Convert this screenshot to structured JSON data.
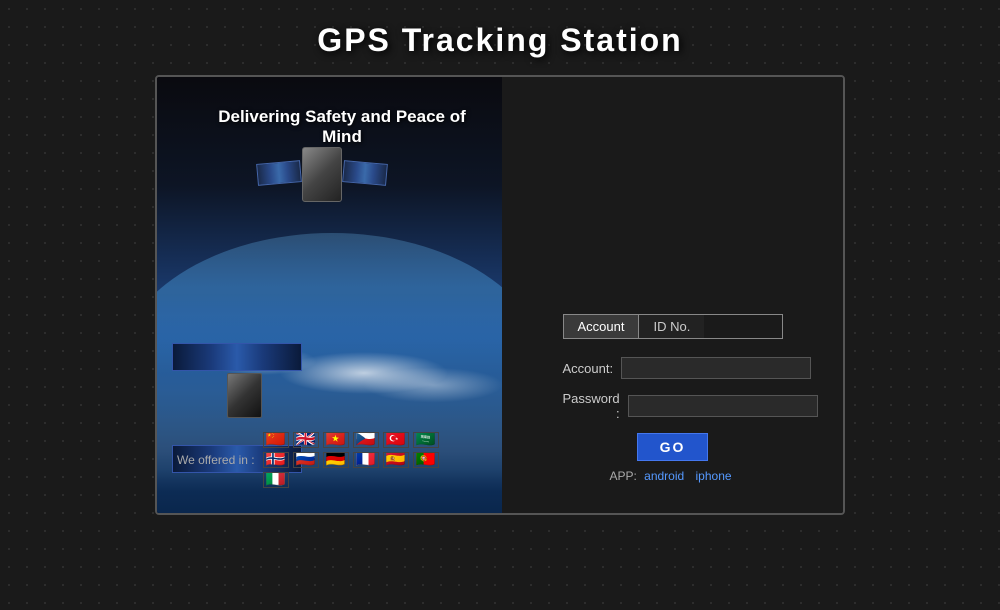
{
  "header": {
    "title": "GPS Tracking Station"
  },
  "tagline": "Delivering Safety and Peace of Mind",
  "tabs": {
    "account": "Account",
    "id_no": "ID No."
  },
  "form": {
    "account_label": "Account:",
    "password_label": "Password :",
    "account_value": "",
    "password_value": ""
  },
  "buttons": {
    "go": "GO"
  },
  "app_links": {
    "prefix": "APP:",
    "android": "android",
    "iphone": "iphone"
  },
  "languages": {
    "label": "We offered in :",
    "flags": [
      "🇨🇳",
      "🇬🇧",
      "🇻🇳",
      "🇨🇿",
      "🇹🇷",
      "🇸🇦",
      "🇳🇴",
      "🇷🇺",
      "🇩🇪",
      "🇫🇷",
      "🇪🇸",
      "🇵🇹",
      "🇮🇹"
    ]
  }
}
